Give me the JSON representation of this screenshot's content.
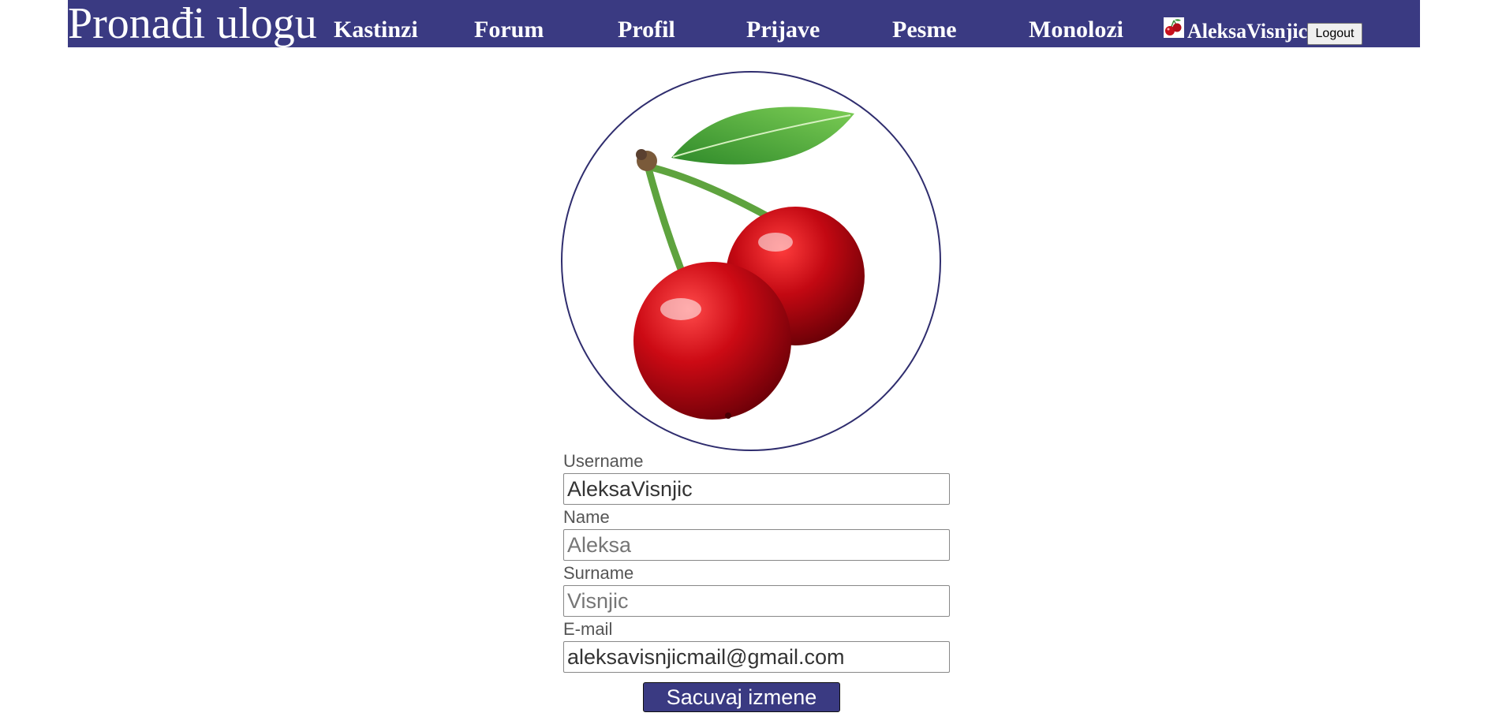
{
  "navbar": {
    "brand": "Pronađi ulogu",
    "links": [
      "Kastinzi",
      "Forum",
      "Profil",
      "Prijave",
      "Pesme",
      "Monolozi"
    ],
    "username": "AleksaVisnjic",
    "logout_label": "Logout",
    "background_color": "#3a3a82"
  },
  "profile": {
    "avatar_icon": "cherry-image",
    "fields": {
      "username": {
        "label": "Username",
        "value": "AleksaVisnjic",
        "placeholder": ""
      },
      "name": {
        "label": "Name",
        "value": "",
        "placeholder": "Aleksa"
      },
      "surname": {
        "label": "Surname",
        "value": "",
        "placeholder": "Visnjic"
      },
      "email": {
        "label": "E-mail",
        "value": "aleksavisnjicmail@gmail.com",
        "placeholder": ""
      }
    },
    "save_label": "Sacuvaj izmene"
  }
}
